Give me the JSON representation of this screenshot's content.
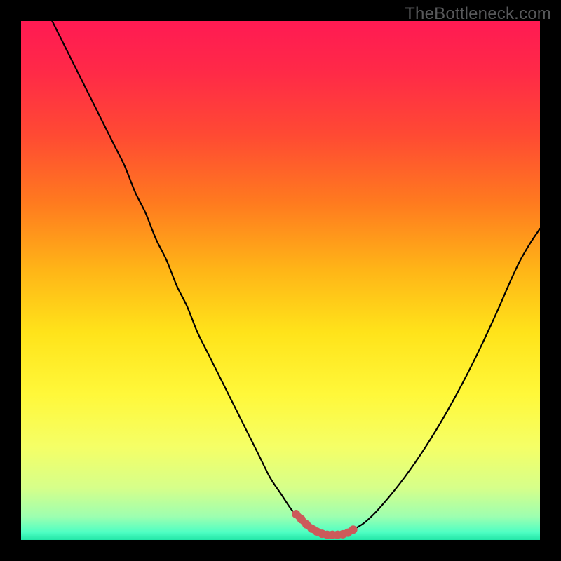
{
  "watermark": "TheBottleneck.com",
  "colors": {
    "frame": "#000000",
    "gradient_stops": [
      {
        "offset": 0.0,
        "color": "#ff1a53"
      },
      {
        "offset": 0.1,
        "color": "#ff2a47"
      },
      {
        "offset": 0.22,
        "color": "#ff4a33"
      },
      {
        "offset": 0.35,
        "color": "#ff7a1f"
      },
      {
        "offset": 0.48,
        "color": "#ffb517"
      },
      {
        "offset": 0.6,
        "color": "#ffe31a"
      },
      {
        "offset": 0.72,
        "color": "#fff83a"
      },
      {
        "offset": 0.82,
        "color": "#f5ff66"
      },
      {
        "offset": 0.9,
        "color": "#d6ff8a"
      },
      {
        "offset": 0.955,
        "color": "#9dffb0"
      },
      {
        "offset": 0.985,
        "color": "#4fffc3"
      },
      {
        "offset": 1.0,
        "color": "#22e6a7"
      }
    ],
    "curve": "#000000",
    "marker": "#cc5a5a"
  },
  "chart_data": {
    "type": "line",
    "title": "",
    "xlabel": "",
    "ylabel": "",
    "xlim": [
      0,
      100
    ],
    "ylim": [
      0,
      100
    ],
    "series": [
      {
        "name": "bottleneck-curve",
        "x": [
          6,
          8,
          10,
          12,
          14,
          16,
          18,
          20,
          22,
          24,
          26,
          28,
          30,
          32,
          34,
          36,
          38,
          40,
          42,
          44,
          46,
          48,
          50,
          52,
          53,
          54,
          55,
          56,
          57,
          58,
          59,
          60,
          61,
          62,
          63,
          64,
          66,
          68,
          70,
          72,
          74,
          76,
          78,
          80,
          82,
          84,
          86,
          88,
          90,
          92,
          94,
          96,
          98,
          100
        ],
        "y": [
          100,
          96,
          92,
          88,
          84,
          80,
          76,
          72,
          67,
          63,
          58,
          54,
          49,
          45,
          40,
          36,
          32,
          28,
          24,
          20,
          16,
          12,
          9,
          6,
          5,
          4,
          3,
          2.2,
          1.6,
          1.2,
          1.0,
          1.0,
          1.0,
          1.1,
          1.4,
          2.0,
          3.2,
          5.0,
          7.2,
          9.6,
          12.2,
          15.0,
          18.0,
          21.2,
          24.6,
          28.2,
          32.0,
          36.0,
          40.2,
          44.6,
          49.2,
          53.5,
          57.0,
          60.0
        ]
      }
    ],
    "markers": {
      "name": "valley-highlight",
      "x": [
        53,
        54,
        55,
        56,
        57,
        58,
        59,
        60,
        61,
        62,
        63,
        64
      ],
      "y": [
        5,
        4,
        3,
        2.2,
        1.6,
        1.2,
        1.0,
        1.0,
        1.0,
        1.1,
        1.4,
        2.0
      ]
    }
  }
}
